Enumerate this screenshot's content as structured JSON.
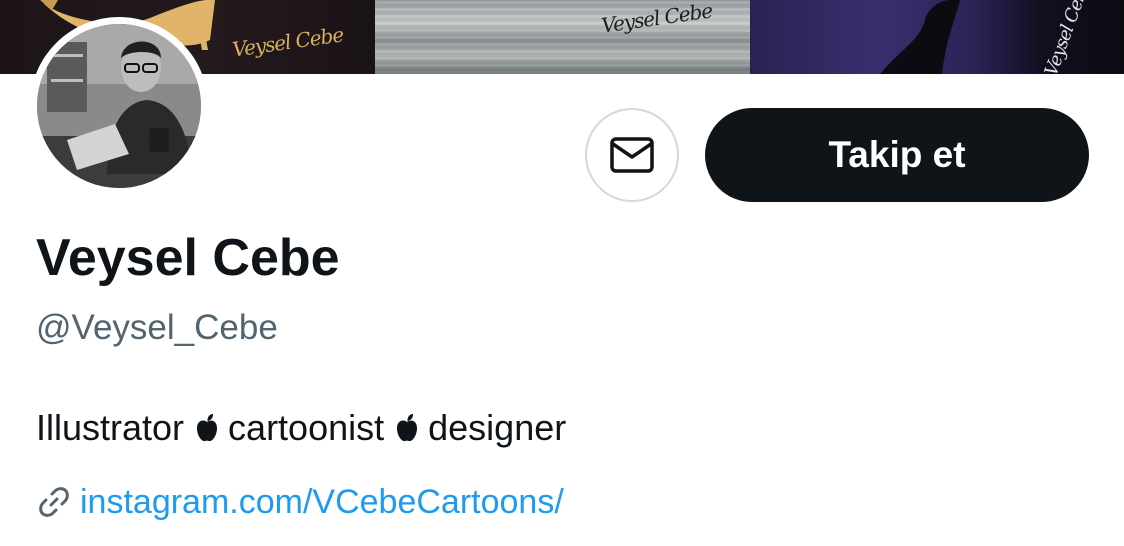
{
  "banner": {
    "signatures": [
      "Veysel Cebe",
      "Veysel Cebe",
      "Veysel Cebe"
    ]
  },
  "actions": {
    "follow_label": "Takip et",
    "message_icon": "envelope-icon"
  },
  "profile": {
    "display_name": "Veysel Cebe",
    "handle": "@Veysel_Cebe",
    "bio_parts": [
      "Illustrator",
      "cartoonist",
      "designer"
    ],
    "bio_separator_icon": "apple-logo-icon",
    "link_icon": "link-icon",
    "link_text": "instagram.com/VCebeCartoons/"
  },
  "colors": {
    "primary_text": "#0f1419",
    "secondary_text": "#536471",
    "link": "#1d9bf0",
    "follow_button_bg": "#0f1419",
    "message_button_border": "#cfd9de"
  }
}
